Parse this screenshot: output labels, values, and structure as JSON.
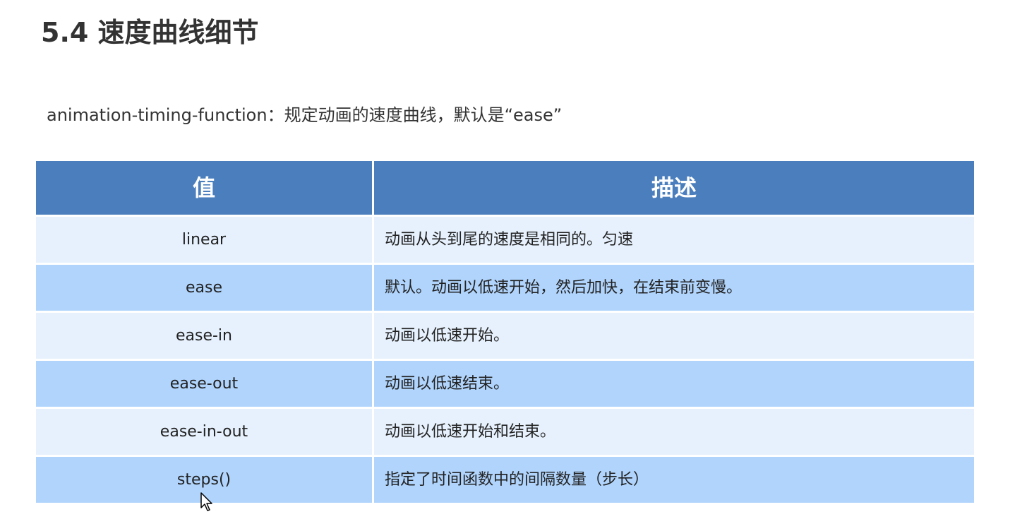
{
  "title": "5.4 速度曲线细节",
  "description": "animation-timing-function：规定动画的速度曲线，默认是“ease”",
  "table": {
    "headers": [
      "值",
      "描述"
    ],
    "rows": [
      {
        "value": "linear",
        "desc": "动画从头到尾的速度是相同的。匀速"
      },
      {
        "value": "ease",
        "desc": "默认。动画以低速开始，然后加快，在结束前变慢。"
      },
      {
        "value": "ease-in",
        "desc": "动画以低速开始。"
      },
      {
        "value": "ease-out",
        "desc": "动画以低速结束。"
      },
      {
        "value": "ease-in-out",
        "desc": "动画以低速开始和结束。"
      },
      {
        "value": "steps()",
        "desc": "指定了时间函数中的间隔数量（步长）"
      }
    ]
  },
  "colors": {
    "header_bg": "#4a7ebd",
    "row_light": "#e6f1fd",
    "row_dark": "#b0d4fc"
  },
  "icons": {
    "cursor": "mouse-pointer-icon"
  }
}
